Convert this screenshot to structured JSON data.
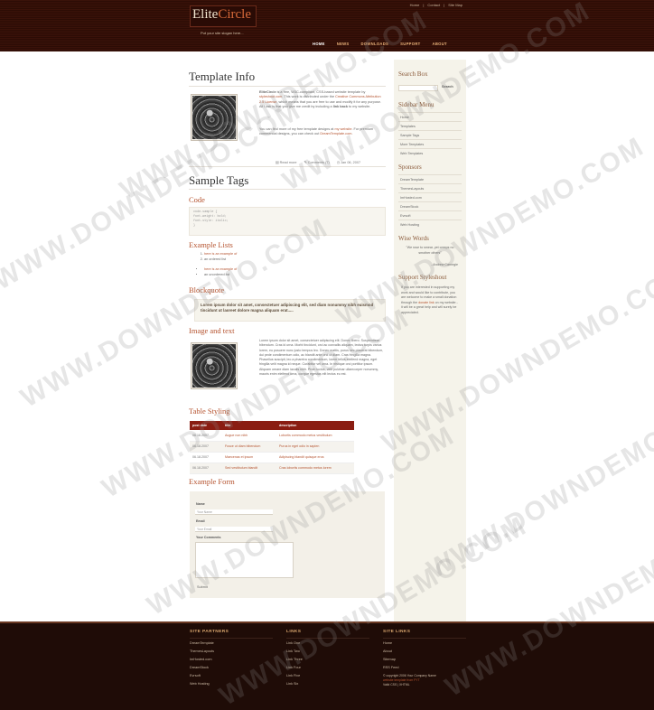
{
  "header": {
    "logo_part1": "Elite",
    "logo_part2": "Circle",
    "slogan": "Put your site slogan here...",
    "top_links": [
      "Home",
      "Contact",
      "Site Map"
    ],
    "nav": [
      "HOME",
      "NEWS",
      "DOWNLOADS",
      "SUPPORT",
      "ABOUT"
    ]
  },
  "content": {
    "title": "Template Info",
    "intro_p1_a": "EliteCircle",
    "intro_p1_b": " is a free, W3C-compliant, CSS-based website template by ",
    "intro_p1_link": "styleshout.com",
    "intro_p1_c": ". This work is distributed under the ",
    "intro_p1_link2": "Creative Commons Attribution 2.5 License",
    "intro_p1_d": ", which means that you are free to use and modify it for any purpose. All I ask is that you give me credit by including a ",
    "intro_p1_bold": "link back",
    "intro_p1_e": " to my website.",
    "intro_p2_a": "You can find more of my free template designs at ",
    "intro_p2_link": "my website",
    "intro_p2_b": ". For premium commercial designs, you can check out ",
    "intro_p2_link2": "DreamTemplate.com",
    "intro_p2_c": ".",
    "post_footer": [
      "Read more",
      "Comments (7)",
      "Jan 06, 2007"
    ],
    "sample_tags_title": "Sample Tags",
    "code_title": "Code",
    "code_lines": [
      "code-sample {",
      "  font-weight: bold;",
      "  font-style: italic;",
      "}"
    ],
    "lists_title": "Example Lists",
    "ordered_list": [
      "here is an example of",
      "an ordered list"
    ],
    "unordered_list": [
      "here is an example of",
      "an unordered list"
    ],
    "blockquote_title": "Blockquote",
    "blockquote_text": "Lorem ipsum dolor sit amet, consectetuer adipiscing elit, sed diam nonummy nibh euismod tincidunt ut laoreet dolore magna aliquam erat.....",
    "image_text_title": "Image and text",
    "image_text": "Lorem ipsum dolor sit amet, consectetuer adipiscing elit. Donec libero. Suspendisse bibendum. Cras id urna. Morbi tincidunt, orci ac convallis aliquam, lectus turpis varius lorem, eu posuere nunc justo tempus leo. Donec mattis, purus nec placerat bibendum, dui pede condimentum odio, ac blandit ante orci ut diam. Cras fringilla magna. Phasellus suscipit, leo a pharetra condimentum, lorem tellus eleifend magna, eget fringilla velit magna id neque. Curabitur vel urna. In tristique orci porttitor ipsum. Aliquam ornare diam iaculis nibh. Proin luctus, velit pulvinar ullamcorper nonummy, mauris enim eleifend urna, congue egestas elit lectus eu est.",
    "table_title": "Table Styling",
    "table_headers": [
      "post date",
      "title",
      "description"
    ],
    "table_rows": [
      [
        "06.18.2007",
        "Augue non nibh",
        "Lobortis commodo metus vestibulum"
      ],
      [
        "06.18.2007",
        "Fusce ut diam bibendum",
        "Purus in eget odio in sapien"
      ],
      [
        "06.18.2007",
        "Maecenas et ipsum",
        "Adipiscing blandit quisque eros"
      ],
      [
        "06.18.2007",
        "Sed vestibulum blandit",
        "Cras lobortis commodo metus lorem"
      ]
    ],
    "form_title": "Example Form",
    "form": {
      "name_label": "Name",
      "name_placeholder": "Your Name",
      "email_label": "Email",
      "email_placeholder": "Your Email",
      "comments_label": "Your Comments",
      "submit": "Submit"
    }
  },
  "sidebar": {
    "search_title": "Search Box",
    "search_button": "Search",
    "menu_title": "Sidebar Menu",
    "menu_items": [
      "Home",
      "Templates",
      "Sample Tags",
      "More Templates",
      "Web Templates"
    ],
    "sponsors_title": "Sponsors",
    "sponsors": [
      "DreamTemplate",
      "ThemesLayouts",
      "ImHosted.com",
      "DreamStock",
      "Evrsoft",
      "Web Hosting"
    ],
    "wise_title": "Wise Words",
    "quote": "\"We rose to smear, yet creeps no smother others\"",
    "quote_author": "- Andrew Carnegie",
    "support_title": "Support Styleshout",
    "support_text": "If you are interested in supporting my work and would like to contribute, you are welcome to make a small donation through the",
    "support_link": "donate link",
    "support_text2": "on my website - it will be a great help and will surely be appreciated."
  },
  "footer": {
    "col1_title": "SITE PARTNERS",
    "col1_items": [
      "DreamTemplate",
      "ThemesLayouts",
      "ImHosted.com",
      "DreamStock",
      "Evrsoft",
      "Web Hosting"
    ],
    "col2_title": "LINKS",
    "col2_items": [
      "Link One",
      "Link Two",
      "Link Three",
      "Link Four",
      "Link Five",
      "Link Six"
    ],
    "col3_title": "SITE LINKS",
    "col3_items": [
      "Home",
      "About",
      "Sitemap",
      "RSS Feed"
    ],
    "copyright": "© copyright 2006 Your Company Name",
    "credits": "website template from FYT",
    "valid": "Valid CSS | XHTML"
  },
  "watermark": "WWW.DOWNDEMO.COM"
}
